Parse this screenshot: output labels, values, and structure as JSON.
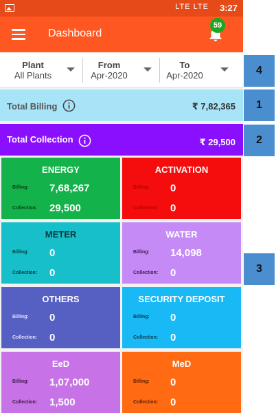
{
  "statusbar": {
    "sys_text": "LTE LTE",
    "time": "3:27"
  },
  "appbar": {
    "title": "Dashboard",
    "notification_count": "59"
  },
  "filters": [
    {
      "label": "Plant",
      "value": "All Plants"
    },
    {
      "label": "From",
      "value": "Apr-2020"
    },
    {
      "label": "To",
      "value": "Apr-2020"
    }
  ],
  "totals": {
    "billing": {
      "label": "Total Billing",
      "value": "₹ 7,82,365"
    },
    "collection": {
      "label": "Total Collection",
      "value": "₹ 29,500"
    }
  },
  "labels": {
    "billing": "Billing:",
    "collection": "Collection:"
  },
  "tiles": [
    {
      "title": "ENERGY",
      "billing": "7,68,267",
      "collection": "29,500",
      "color": "#14b24b"
    },
    {
      "title": "ACTIVATION",
      "billing": "0",
      "collection": "0",
      "color": "#f50d0d"
    },
    {
      "title": "METER",
      "billing": "0",
      "collection": "0",
      "color": "#16bfc9"
    },
    {
      "title": "WATER",
      "billing": "14,098",
      "collection": "0",
      "color": "#c58af5"
    },
    {
      "title": "OTHERS",
      "billing": "0",
      "collection": "0",
      "color": "#5660c2"
    },
    {
      "title": "SECURITY DEPOSIT",
      "billing": "0",
      "collection": "0",
      "color": "#18b9f5"
    },
    {
      "title": "EeD",
      "billing": "1,07,000",
      "collection": "1,500",
      "color": "#c772e6"
    },
    {
      "title": "MeD",
      "billing": "0",
      "collection": "0",
      "color": "#ff6a12"
    }
  ],
  "callouts": [
    "4",
    "1",
    "2",
    "3"
  ],
  "colors": {
    "header": "#ff5722",
    "statusbar": "#e64a19",
    "callout": "#4a8ed0",
    "badge": "#1fa61f"
  }
}
